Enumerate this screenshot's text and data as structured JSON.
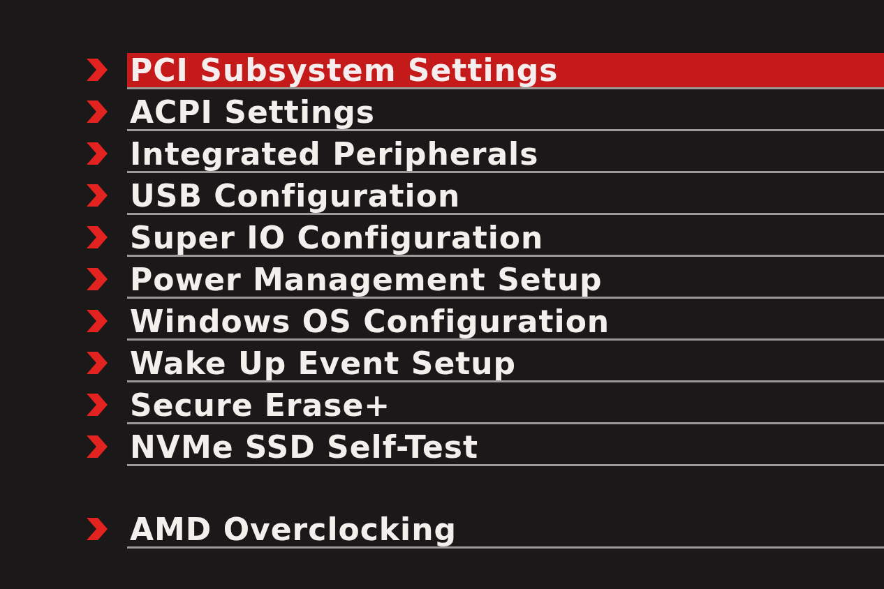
{
  "menu": {
    "groups": [
      {
        "items": [
          {
            "label": "PCI Subsystem Settings",
            "selected": true
          },
          {
            "label": "ACPI Settings",
            "selected": false
          },
          {
            "label": "Integrated Peripherals",
            "selected": false
          },
          {
            "label": "USB Configuration",
            "selected": false
          },
          {
            "label": "Super IO Configuration",
            "selected": false
          },
          {
            "label": "Power Management Setup",
            "selected": false
          },
          {
            "label": "Windows OS Configuration",
            "selected": false
          },
          {
            "label": "Wake Up Event Setup",
            "selected": false
          },
          {
            "label": "Secure Erase+",
            "selected": false
          },
          {
            "label": "NVMe SSD Self-Test",
            "selected": false
          }
        ]
      },
      {
        "items": [
          {
            "label": "AMD Overclocking",
            "selected": false
          }
        ]
      }
    ]
  }
}
